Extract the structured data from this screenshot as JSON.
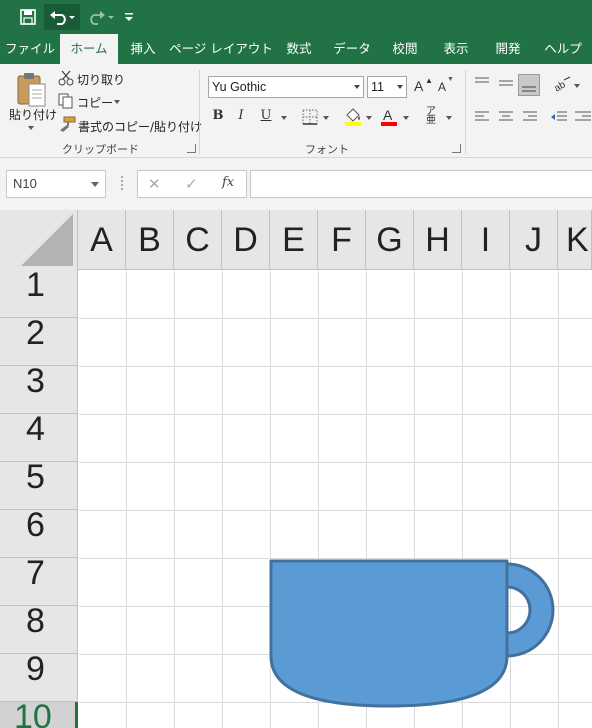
{
  "qat": {
    "save_icon": "save-icon",
    "undo_icon": "undo-icon",
    "redo_icon": "redo-icon",
    "customize_icon": "customize-qat-icon"
  },
  "tabs": [
    "ファイル",
    "ホーム",
    "挿入",
    "ページ レイアウト",
    "数式",
    "データ",
    "校閲",
    "表示",
    "開発",
    "ヘルプ"
  ],
  "active_tab": "ホーム",
  "clipboard": {
    "paste_label": "貼り付け",
    "cut_label": "切り取り",
    "copy_label": "コピー",
    "format_painter_label": "書式のコピー/貼り付け",
    "group_label": "クリップボード"
  },
  "font": {
    "font_name": "Yu Gothic",
    "font_size": "11",
    "bold": "B",
    "italic": "I",
    "underline": "U",
    "group_label": "フォント",
    "fill_color": "#ffff00",
    "font_color": "#ff0000"
  },
  "formula_bar": {
    "name_box": "N10",
    "cancel": "✕",
    "enter": "✓",
    "fx": "fx",
    "value": ""
  },
  "columns": [
    "A",
    "B",
    "C",
    "D",
    "E",
    "F",
    "G",
    "H",
    "I",
    "J",
    "K"
  ],
  "rows": [
    "1",
    "2",
    "3",
    "4",
    "5",
    "6",
    "7",
    "8",
    "9",
    "10"
  ],
  "active_row": "10",
  "shape": {
    "type": "cup",
    "fill": "#5b9bd5",
    "stroke": "#41719c"
  },
  "colors": {
    "ribbon_green": "#217346"
  }
}
